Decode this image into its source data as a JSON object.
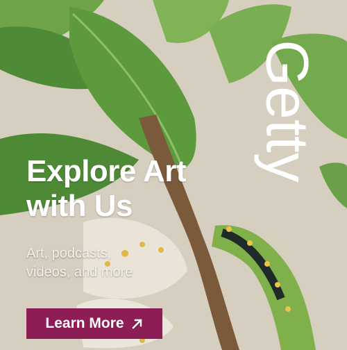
{
  "brand": {
    "logo_text": "Getty"
  },
  "headline": {
    "line1": "Explore Art",
    "line2": "with Us"
  },
  "subtext": {
    "line1": "Art, podcasts,",
    "line2": "videos, and more"
  },
  "cta": {
    "label": "Learn More",
    "icon": "arrow-up-right-icon"
  },
  "colors": {
    "button": "#8c1d55",
    "background": "#d6cfbf",
    "leaf": "#5a9a40",
    "caterpillar": "#7fb04a"
  }
}
